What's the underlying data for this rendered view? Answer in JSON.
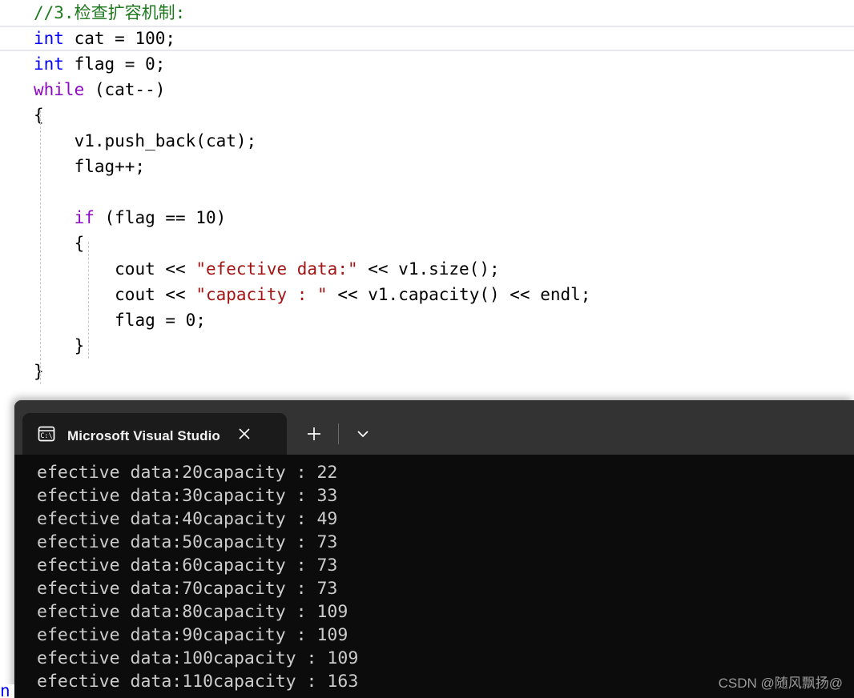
{
  "editor": {
    "lines": [
      {
        "indent": 0,
        "tokens": [
          {
            "t": "comment",
            "s": "//3.检查扩容机制:"
          }
        ]
      },
      {
        "indent": 0,
        "current": true,
        "tokens": [
          {
            "t": "keyword",
            "s": "int"
          },
          {
            "t": "plain",
            "s": " cat = 100;"
          }
        ]
      },
      {
        "indent": 0,
        "tokens": [
          {
            "t": "keyword",
            "s": "int"
          },
          {
            "t": "plain",
            "s": " flag = 0;"
          }
        ]
      },
      {
        "indent": 0,
        "tokens": [
          {
            "t": "ctrl",
            "s": "while"
          },
          {
            "t": "plain",
            "s": " (cat--)"
          }
        ]
      },
      {
        "indent": 0,
        "tokens": [
          {
            "t": "plain",
            "s": "{"
          }
        ]
      },
      {
        "indent": 1,
        "tokens": [
          {
            "t": "plain",
            "s": "v1.push_back(cat);"
          }
        ]
      },
      {
        "indent": 1,
        "tokens": [
          {
            "t": "plain",
            "s": "flag++;"
          }
        ]
      },
      {
        "indent": 1,
        "tokens": [
          {
            "t": "plain",
            "s": ""
          }
        ]
      },
      {
        "indent": 1,
        "tokens": [
          {
            "t": "ctrl",
            "s": "if"
          },
          {
            "t": "plain",
            "s": " (flag == 10)"
          }
        ]
      },
      {
        "indent": 1,
        "tokens": [
          {
            "t": "plain",
            "s": "{"
          }
        ]
      },
      {
        "indent": 2,
        "tokens": [
          {
            "t": "plain",
            "s": "cout << "
          },
          {
            "t": "string",
            "s": "\"efective data:\""
          },
          {
            "t": "plain",
            "s": " << v1.size();"
          }
        ]
      },
      {
        "indent": 2,
        "tokens": [
          {
            "t": "plain",
            "s": "cout << "
          },
          {
            "t": "string",
            "s": "\"capacity : \""
          },
          {
            "t": "plain",
            "s": " << v1.capacity() << endl;"
          }
        ]
      },
      {
        "indent": 2,
        "tokens": [
          {
            "t": "plain",
            "s": "flag = 0;"
          }
        ]
      },
      {
        "indent": 1,
        "tokens": [
          {
            "t": "plain",
            "s": "}"
          }
        ]
      },
      {
        "indent": 0,
        "tokens": [
          {
            "t": "plain",
            "s": "}"
          }
        ]
      }
    ],
    "bleed_fragment": "n"
  },
  "terminal": {
    "tab": {
      "icon": "console-cmd-icon",
      "title": "Microsoft Visual Studio 调试控",
      "close_label": "✕"
    },
    "actions": {
      "new_tab_label": "+",
      "dropdown_label": "⌄"
    },
    "output_lines": [
      "efective data:20capacity : 22",
      "efective data:30capacity : 33",
      "efective data:40capacity : 49",
      "efective data:50capacity : 73",
      "efective data:60capacity : 73",
      "efective data:70capacity : 73",
      "efective data:80capacity : 109",
      "efective data:90capacity : 109",
      "efective data:100capacity : 109",
      "efective data:110capacity : 163"
    ],
    "watermark": "CSDN @随风飘扬@"
  },
  "colors": {
    "comment": "#1f7a1f",
    "keyword": "#0000ff",
    "control": "#8f08c4",
    "string": "#a31515",
    "terminal_bg": "#0c0c0c",
    "titlebar_bg": "#333333",
    "tab_bg": "#1b1b1b",
    "output_text": "#cccccc"
  }
}
